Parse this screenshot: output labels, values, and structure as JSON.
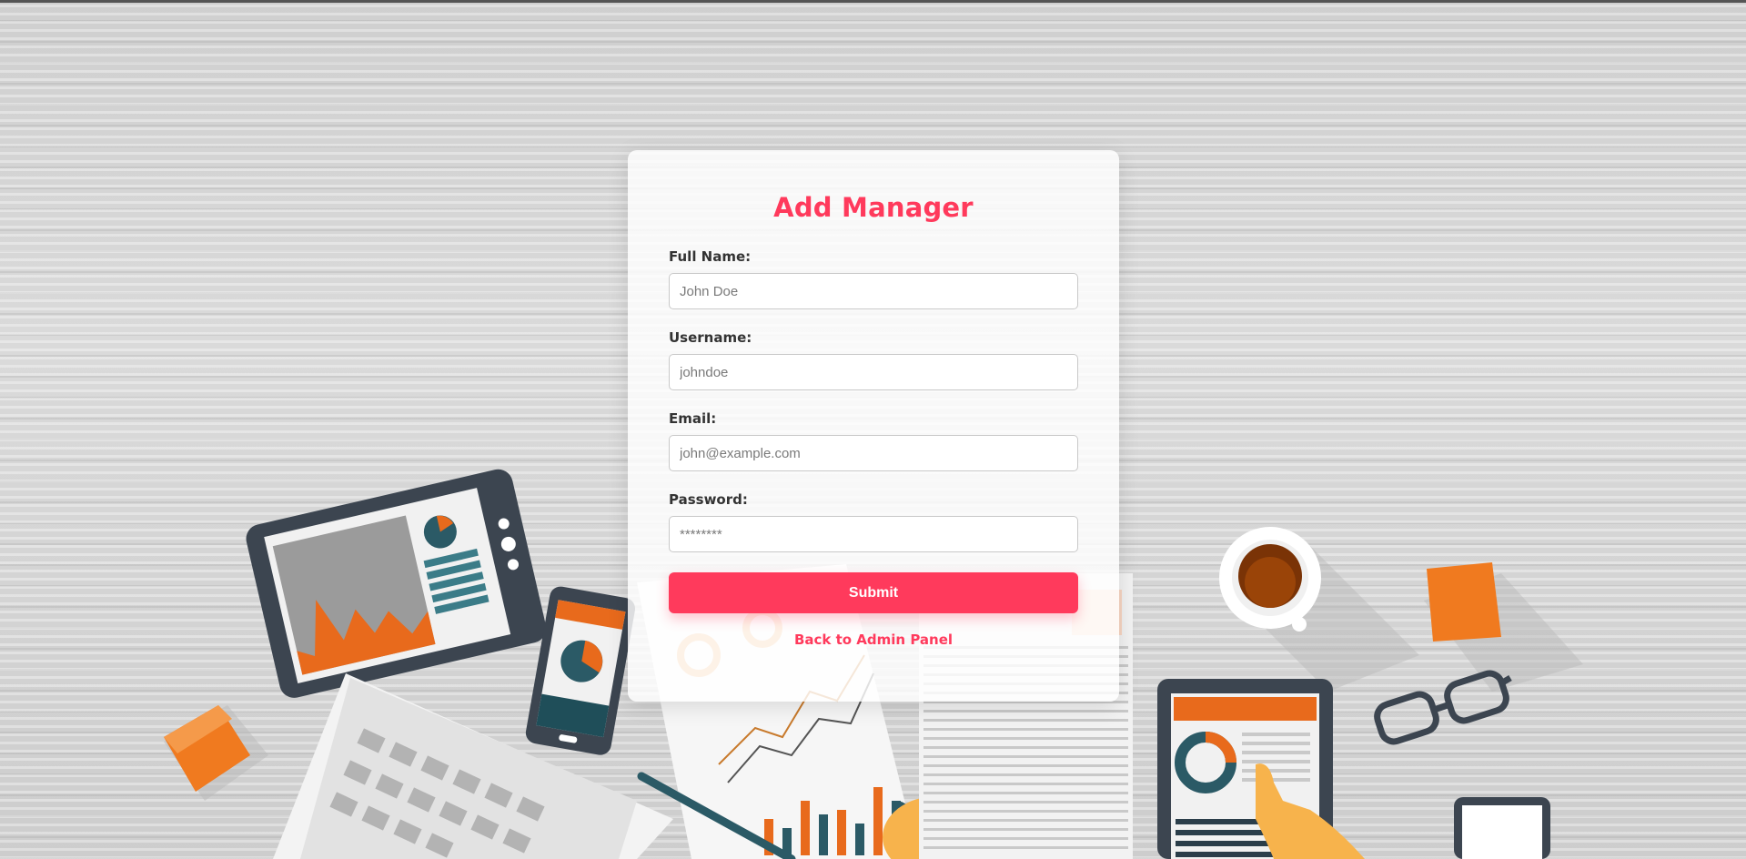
{
  "form": {
    "title": "Add Manager",
    "fields": [
      {
        "label": "Full Name:",
        "placeholder": "John Doe",
        "type": "text"
      },
      {
        "label": "Username:",
        "placeholder": "johndoe",
        "type": "text"
      },
      {
        "label": "Email:",
        "placeholder": "john@example.com",
        "type": "email"
      },
      {
        "label": "Password:",
        "placeholder": "********",
        "type": "password"
      }
    ],
    "submit_label": "Submit",
    "back_link": "Back to Admin Panel"
  },
  "colors": {
    "accent": "#ff3a5c",
    "label_text": "#333333",
    "card_background": "rgba(255,255,255,0.82)",
    "illustration_orange": "#f07a1f",
    "illustration_dark": "#3c4550",
    "illustration_teal": "#2b6a76"
  }
}
